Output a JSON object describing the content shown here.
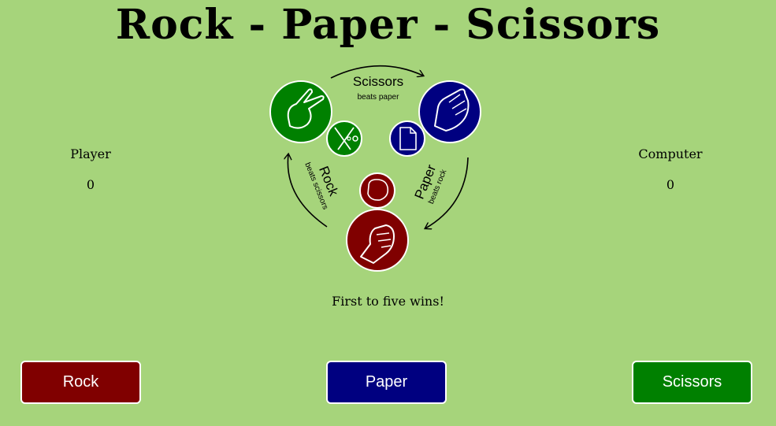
{
  "title": "Rock - Paper - Scissors",
  "player": {
    "label": "Player",
    "score": "0"
  },
  "computer": {
    "label": "Computer",
    "score": "0"
  },
  "rules_text": "First to five wins!",
  "diagram": {
    "scissors": {
      "name": "Scissors",
      "beats": "beats paper",
      "color": "#008000"
    },
    "paper": {
      "name": "Paper",
      "beats": "beats rock",
      "color": "#000080"
    },
    "rock": {
      "name": "Rock",
      "beats": "beats scissors",
      "color": "#800000"
    }
  },
  "buttons": {
    "rock": {
      "label": "Rock",
      "color": "#800000"
    },
    "paper": {
      "label": "Paper",
      "color": "#000080"
    },
    "scissors": {
      "label": "Scissors",
      "color": "#008000"
    }
  },
  "icons": {
    "scissors_hand": "scissors-hand-icon",
    "paper_hand": "paper-hand-icon",
    "rock_hand": "rock-fist-icon",
    "scissors_object": "scissors-icon",
    "paper_object": "document-icon",
    "rock_object": "rock-icon"
  }
}
